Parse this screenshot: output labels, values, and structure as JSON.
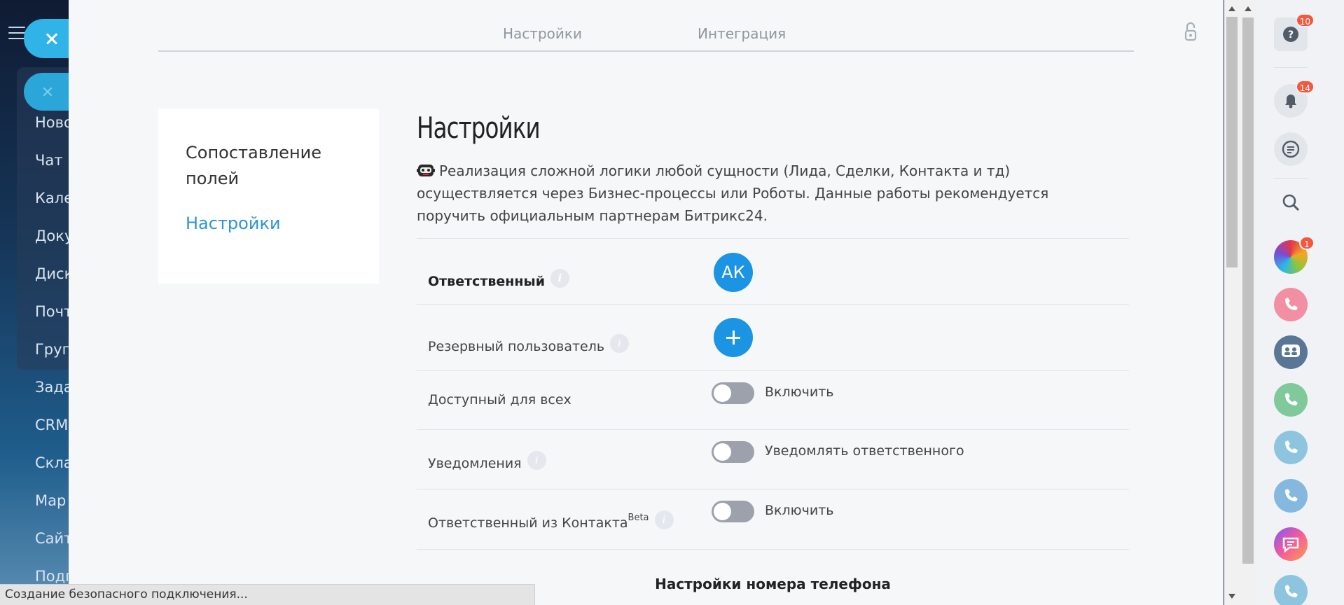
{
  "background_menu": {
    "items": [
      "Ново",
      "Чат и",
      "Кале",
      "Доку",
      "Диск",
      "Почт",
      "Груп",
      "Зада",
      "CRM",
      "Скла",
      "Мар",
      "Сайт",
      "Подп"
    ]
  },
  "tabs": [
    {
      "label": "Настройки"
    },
    {
      "label": "Интеграция"
    }
  ],
  "left_nav": {
    "item1": "Сопоставление полей",
    "item2": "Настройки"
  },
  "content": {
    "title": "Настройки",
    "intro": "Реализация сложной логики любой сущности (Лида, Сделки, Контакта и тд) осуществляется через Бизнес-процессы или Роботы. Данные работы рекомендуется поручить официальным партнерам Битрикс24.",
    "rows": {
      "responsible": {
        "label": "Ответственный",
        "avatar": "АК"
      },
      "reserve": {
        "label": "Резервный пользователь"
      },
      "available": {
        "label": "Доступный для всех",
        "toggle_label": "Включить"
      },
      "notifications": {
        "label": "Уведомления",
        "toggle_label": "Уведомлять ответственного"
      },
      "from_contact": {
        "label": "Ответственный из Контакта",
        "sup": "Beta",
        "toggle_label": "Включить"
      }
    },
    "phone_settings": "Настройки номера телефона"
  },
  "rightbar": {
    "help_badge": "10",
    "notify_badge": "14",
    "app_badge": "1"
  },
  "status_bar": "Создание безопасного подключения..."
}
